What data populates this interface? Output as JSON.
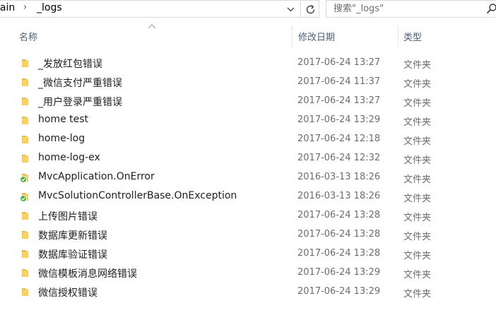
{
  "address": {
    "breadcrumbs": [
      "lain",
      "_logs"
    ],
    "separator": "›"
  },
  "search": {
    "placeholder": "搜索\"_logs\""
  },
  "columns": {
    "name": "名称",
    "date": "修改日期",
    "type": "类型"
  },
  "colors": {
    "folder": "#ffd25c",
    "folder_dark": "#e8b84a",
    "sync_check": "#3fae35",
    "header_text": "#4c607a"
  },
  "items": [
    {
      "name": "_发放红包错误",
      "date": "2017-06-24 13:27",
      "type": "文件夹",
      "icon": "folder-icon"
    },
    {
      "name": "_微信支付严重错误",
      "date": "2017-06-24 11:37",
      "type": "文件夹",
      "icon": "folder-icon"
    },
    {
      "name": "_用户登录严重错误",
      "date": "2017-06-24 13:27",
      "type": "文件夹",
      "icon": "folder-icon"
    },
    {
      "name": "home test",
      "date": "2017-06-24 13:29",
      "type": "文件夹",
      "icon": "folder-icon"
    },
    {
      "name": "home-log",
      "date": "2017-06-24 12:18",
      "type": "文件夹",
      "icon": "folder-icon"
    },
    {
      "name": "home-log-ex",
      "date": "2017-06-24 12:32",
      "type": "文件夹",
      "icon": "folder-icon"
    },
    {
      "name": "MvcApplication.OnError",
      "date": "2016-03-13 18:26",
      "type": "文件夹",
      "icon": "folder-synced-icon"
    },
    {
      "name": "MvcSolutionControllerBase.OnException",
      "date": "2016-03-13 18:26",
      "type": "文件夹",
      "icon": "folder-synced-icon"
    },
    {
      "name": "上传图片错误",
      "date": "2017-06-24 13:28",
      "type": "文件夹",
      "icon": "folder-icon"
    },
    {
      "name": "数据库更新错误",
      "date": "2017-06-24 13:28",
      "type": "文件夹",
      "icon": "folder-icon"
    },
    {
      "name": "数据库验证错误",
      "date": "2017-06-24 13:28",
      "type": "文件夹",
      "icon": "folder-icon"
    },
    {
      "name": "微信模板消息网络错误",
      "date": "2017-06-24 13:29",
      "type": "文件夹",
      "icon": "folder-icon"
    },
    {
      "name": "微信授权错误",
      "date": "2017-06-24 13:29",
      "type": "文件夹",
      "icon": "folder-icon"
    }
  ]
}
